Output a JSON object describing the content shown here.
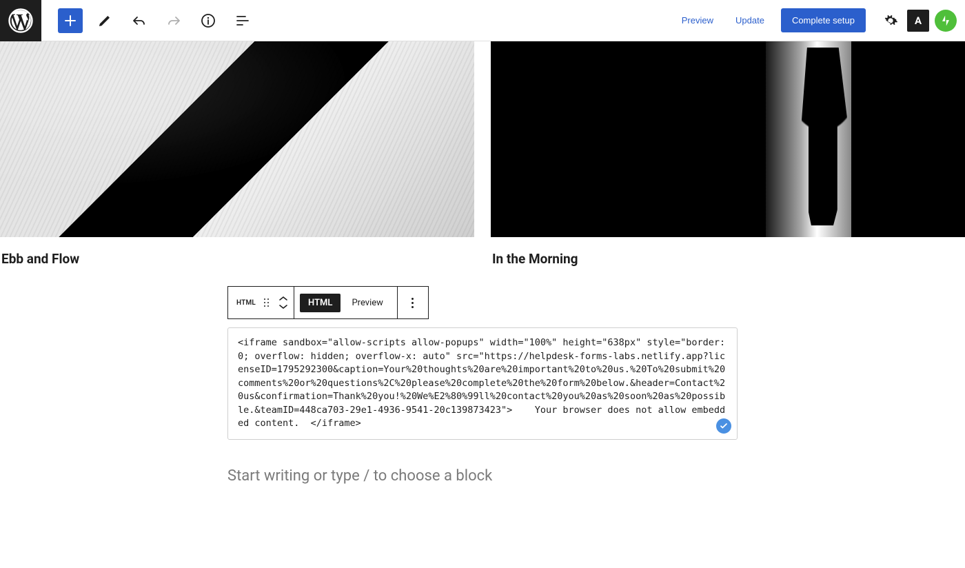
{
  "header": {
    "preview_label": "Preview",
    "update_label": "Update",
    "complete_setup_label": "Complete setup",
    "a11y_letter": "A"
  },
  "gallery": {
    "left_caption": "Ebb and Flow",
    "right_caption": "In the Morning"
  },
  "block_toolbar": {
    "type_label": "HTML",
    "html_tab": "HTML",
    "preview_tab": "Preview"
  },
  "html_block": {
    "code": "<iframe sandbox=\"allow-scripts allow-popups\" width=\"100%\" height=\"638px\" style=\"border: 0; overflow: hidden; overflow-x: auto\" src=\"https://helpdesk-forms-labs.netlify.app?licenseID=1795292300&caption=Your%20thoughts%20are%20important%20to%20us.%20To%20submit%20comments%20or%20questions%2C%20please%20complete%20the%20form%20below.&header=Contact%20us&confirmation=Thank%20you!%20We%E2%80%99ll%20contact%20you%20as%20soon%20as%20possible.&teamID=448ca703-29e1-4936-9541-20c139873423\">    Your browser does not allow embedded content.  </iframe>"
  },
  "editor": {
    "placeholder": "Start writing or type / to choose a block"
  }
}
